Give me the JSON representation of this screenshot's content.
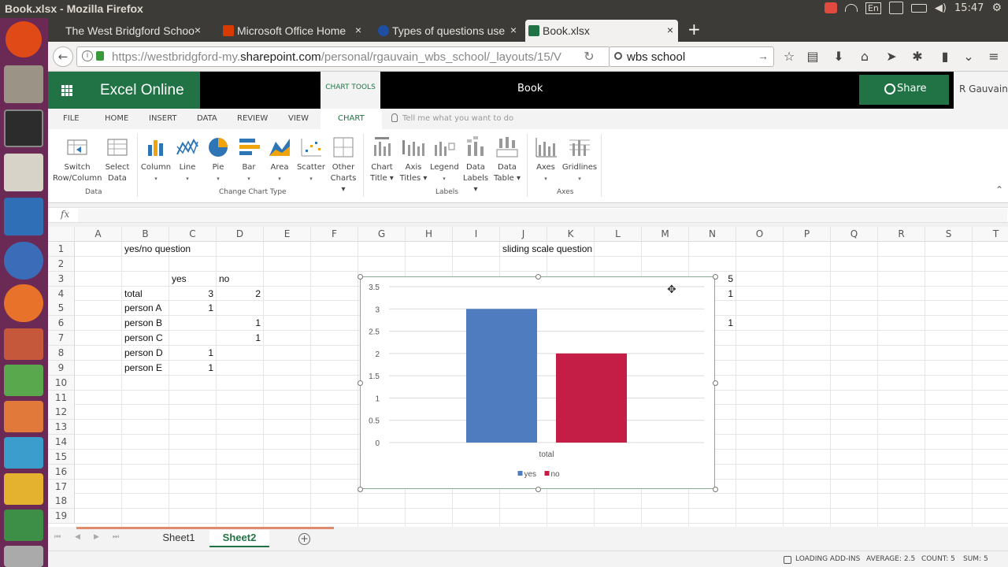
{
  "window": {
    "title": "Book.xlsx - Mozilla Firefox",
    "clock": "15:47",
    "keyboard": "En"
  },
  "browser": {
    "tabs": [
      {
        "label": "The West Bridgford Schoo",
        "favicon_color": "#3b5998"
      },
      {
        "label": "Microsoft Office Home",
        "favicon_color": "#d83b01"
      },
      {
        "label": "Types of questions use",
        "favicon_color": "#1e4fa3"
      },
      {
        "label": "Book.xlsx",
        "favicon_color": "#217346"
      }
    ],
    "close_glyph": "×",
    "new_tab_glyph": "+",
    "url_prefix": "https://westbridgford-my.",
    "url_domain": "sharepoint.com",
    "url_rest": "/personal/rgauvain_wbs_school/_layouts/15/V",
    "search_value": "wbs school"
  },
  "office": {
    "app_name": "Excel Online",
    "chart_tools_label": "CHART TOOLS",
    "book_name": "Book",
    "share_label": "Share",
    "user_name": "R Gauvain",
    "accent": "#217346"
  },
  "ribbon": {
    "tabs": [
      "FILE",
      "HOME",
      "INSERT",
      "DATA",
      "REVIEW",
      "VIEW",
      "CHART"
    ],
    "active_tab": "CHART",
    "tell_me": "Tell me what you want to do",
    "buttons": [
      {
        "id": "switch",
        "line1": "Switch",
        "line2": "Row/Column",
        "dd": ""
      },
      {
        "id": "select",
        "line1": "Select",
        "line2": "Data",
        "dd": ""
      },
      {
        "id": "column",
        "line1": "Column",
        "line2": "",
        "dd": "▾"
      },
      {
        "id": "line",
        "line1": "Line",
        "line2": "",
        "dd": "▾"
      },
      {
        "id": "pie",
        "line1": "Pie",
        "line2": "",
        "dd": "▾"
      },
      {
        "id": "bar",
        "line1": "Bar",
        "line2": "",
        "dd": "▾"
      },
      {
        "id": "area",
        "line1": "Area",
        "line2": "",
        "dd": "▾"
      },
      {
        "id": "scatter",
        "line1": "Scatter",
        "line2": "",
        "dd": "▾"
      },
      {
        "id": "other",
        "line1": "Other",
        "line2": "Charts ▾",
        "dd": ""
      },
      {
        "id": "charttitle",
        "line1": "Chart",
        "line2": "Title ▾",
        "dd": ""
      },
      {
        "id": "axistitles",
        "line1": "Axis",
        "line2": "Titles ▾",
        "dd": ""
      },
      {
        "id": "legend",
        "line1": "Legend",
        "line2": "",
        "dd": "▾"
      },
      {
        "id": "datalabels",
        "line1": "Data",
        "line2": "Labels ▾",
        "dd": ""
      },
      {
        "id": "datatable",
        "line1": "Data",
        "line2": "Table ▾",
        "dd": ""
      },
      {
        "id": "axes",
        "line1": "Axes",
        "line2": "",
        "dd": "▾"
      },
      {
        "id": "gridlines",
        "line1": "Gridlines",
        "line2": "",
        "dd": "▾"
      }
    ],
    "groups": [
      "Data",
      "Change Chart Type",
      "Labels",
      "Axes"
    ]
  },
  "formula_bar": {
    "fx": "fx",
    "value": ""
  },
  "grid": {
    "columns": [
      "A",
      "B",
      "C",
      "D",
      "E",
      "F",
      "G",
      "H",
      "I",
      "J",
      "K",
      "L",
      "M",
      "N",
      "O",
      "P",
      "Q",
      "R",
      "S",
      "T"
    ],
    "rows": [
      "1",
      "2",
      "3",
      "4",
      "5",
      "6",
      "7",
      "8",
      "9",
      "10",
      "11",
      "12",
      "13",
      "14",
      "15",
      "16",
      "17",
      "18",
      "19"
    ],
    "cells": {
      "B1": "yes/no question",
      "J1": "sliding scale question",
      "C3": "yes",
      "D3": "no",
      "B4": "total",
      "C4": "3",
      "D4": "2",
      "B5": "person A",
      "C5": "1",
      "B6": "person B",
      "D6": "1",
      "B7": "person C",
      "D7": "1",
      "B8": "person D",
      "C8": "1",
      "B9": "person E",
      "C9": "1",
      "N3": "5",
      "N4": "1",
      "N6": "1"
    }
  },
  "chart_data": {
    "type": "bar",
    "categories": [
      "total"
    ],
    "series": [
      {
        "name": "yes",
        "values": [
          3
        ],
        "color": "#4f7bbf"
      },
      {
        "name": "no",
        "values": [
          2
        ],
        "color": "#c41e46"
      }
    ],
    "yticks": [
      "0",
      "0.5",
      "1",
      "1.5",
      "2",
      "2.5",
      "3",
      "3.5"
    ],
    "ylim": [
      0,
      3.5
    ],
    "grid": true,
    "legend": "bottom"
  },
  "sheets": {
    "tabs": [
      "Sheet1",
      "Sheet2"
    ],
    "active": "Sheet2",
    "add_glyph": "+"
  },
  "status": {
    "loading": "LOADING ADD-INS",
    "average": "AVERAGE: 2.5",
    "count": "COUNT: 5",
    "sum": "SUM: 5"
  }
}
